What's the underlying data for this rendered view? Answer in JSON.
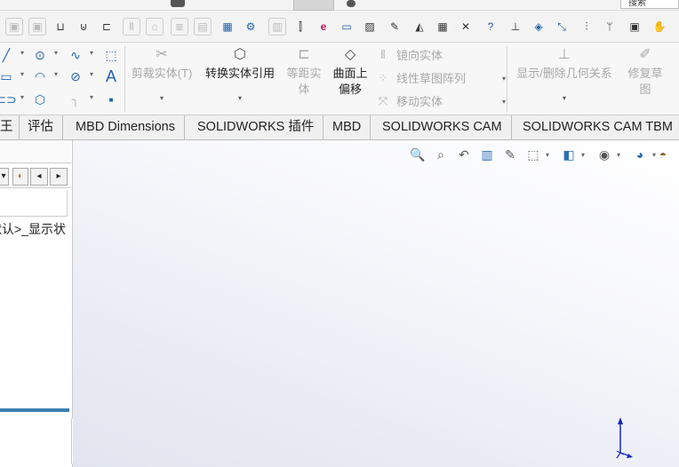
{
  "titlebar": {
    "help_text": "搜索"
  },
  "colors": {
    "accent": "#1e63b0",
    "tab_underline": "#3c7db3",
    "disabled": "#a8a8a8"
  },
  "ribbon": {
    "sketch_icons": [
      "line-icon",
      "circle-icon",
      "spline-icon",
      "rectangle-icon",
      "arc-icon",
      "ellipse-icon",
      "slot-icon",
      "polygon-icon",
      "fillet-icon",
      "text-icon",
      "point-icon",
      "construction-box-icon"
    ],
    "trim": {
      "label": "剪裁实体(T)"
    },
    "convert": {
      "label": "转换实体引用"
    },
    "offset": {
      "label": "等距实体"
    },
    "offset_surface": {
      "label_line1": "曲面上",
      "label_line2": "偏移"
    },
    "mirror": {
      "label": "镜向实体"
    },
    "pattern": {
      "label": "线性草图阵列"
    },
    "move": {
      "label": "移动实体"
    },
    "relations": {
      "label": "显示/删除几何关系"
    },
    "repair": {
      "label_line1": "修复草",
      "label_line2": "图"
    }
  },
  "tabs": [
    {
      "label": "王"
    },
    {
      "label": "评估"
    },
    {
      "label": "MBD Dimensions"
    },
    {
      "label": "SOLIDWORKS 插件"
    },
    {
      "label": "MBD"
    },
    {
      "label": "SOLIDWORKS CAM"
    },
    {
      "label": "SOLIDWORKS CAM TBM"
    }
  ],
  "left_panel": {
    "config_text": "默认>_显示状"
  },
  "hud_icons": [
    "zoom-to-fit-icon",
    "zoom-to-area-icon",
    "previous-view-icon",
    "section-view-icon",
    "dynamic-annotation-icon",
    "view-orientation-icon",
    "display-style-icon",
    "hide-show-icon",
    "edit-appearance-icon",
    "apply-scene-icon"
  ]
}
